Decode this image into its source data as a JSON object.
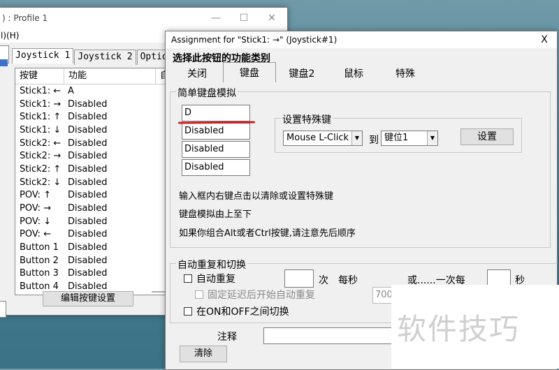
{
  "back_window": {
    "title": ") : Profile 1",
    "menu": "l)(H)",
    "tabs": [
      "Joystick 1",
      "Joystick 2",
      "Options"
    ],
    "columns": [
      "按键",
      "功能",
      "自"
    ],
    "rows": [
      {
        "key": "Stick1: ←",
        "func": "A"
      },
      {
        "key": "Stick1: →",
        "func": "Disabled"
      },
      {
        "key": "Stick1: ↑",
        "func": "Disabled"
      },
      {
        "key": "Stick1: ↓",
        "func": "Disabled"
      },
      {
        "key": "Stick2: ←",
        "func": "Disabled"
      },
      {
        "key": "Stick2: →",
        "func": "Disabled"
      },
      {
        "key": "Stick2: ↑",
        "func": "Disabled"
      },
      {
        "key": "Stick2: ↓",
        "func": "Disabled"
      },
      {
        "key": "POV: ↑",
        "func": "Disabled"
      },
      {
        "key": "POV: →",
        "func": "Disabled"
      },
      {
        "key": "POV: ↓",
        "func": "Disabled"
      },
      {
        "key": "POV: ←",
        "func": "Disabled"
      },
      {
        "key": "Button 1",
        "func": "Disabled"
      },
      {
        "key": "Button 2",
        "func": "Disabled"
      },
      {
        "key": "Button 3",
        "func": "Disabled"
      },
      {
        "key": "Button 4",
        "func": "Disabled"
      }
    ],
    "edit_button": "编辑按键设置"
  },
  "dialog": {
    "title": "Assignment for \"Stick1: →\" (Joystick#1)",
    "close": "X",
    "heading": "选择此按钮的功能类别",
    "tabs": [
      "关闭",
      "键盘",
      "键盘2",
      "鼠标",
      "特殊"
    ],
    "simple_group": "简单键盘模拟",
    "keys": [
      "D",
      "Disabled",
      "Disabled",
      "Disabled"
    ],
    "special_group": "设置特殊键",
    "special_select": "Mouse L-Click",
    "to_label": "到",
    "slot_select": "键位1",
    "set_button": "设置",
    "hints": [
      "输入框内右键点击以清除或设置特殊键",
      "键盘模拟由上至下",
      "如果你组合Alt或者Ctrl按键,请注意先后顺序"
    ],
    "repeat_group": "自动重复和切换",
    "auto_repeat": "自动重复",
    "times_label": "次",
    "per_second": "每秒",
    "or_once_per": "或......一次每",
    "seconds": "秒",
    "fixed_delay": "固定延迟后开始自动重复",
    "delay_value": "700",
    "toggle": "在ON和OFF之间切换",
    "note_label": "注释",
    "clear_button": "清除"
  },
  "watermark": "软件技巧",
  "colors": {
    "underline": "#cc2020"
  }
}
